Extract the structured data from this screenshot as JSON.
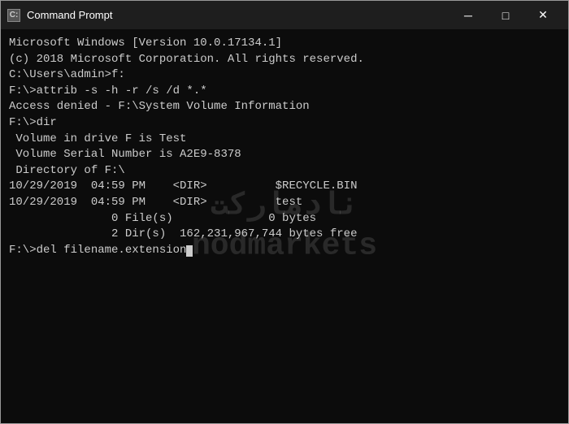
{
  "window": {
    "title": "Command Prompt",
    "icon_label": "C:",
    "controls": {
      "minimize": "─",
      "maximize": "□",
      "close": "✕"
    }
  },
  "terminal": {
    "lines": [
      "Microsoft Windows [Version 10.0.17134.1]",
      "(c) 2018 Microsoft Corporation. All rights reserved.",
      "",
      "C:\\Users\\admin>f:",
      "",
      "F:\\>attrib -s -h -r /s /d *.*",
      "Access denied - F:\\System Volume Information",
      "",
      "F:\\>dir",
      " Volume in drive F is Test",
      " Volume Serial Number is A2E9-8378",
      "",
      " Directory of F:\\",
      "",
      "10/29/2019  04:59 PM    <DIR>          $RECYCLE.BIN",
      "10/29/2019  04:59 PM    <DIR>          test",
      "               0 File(s)              0 bytes",
      "               2 Dir(s)  162,231,967,744 bytes free",
      "",
      "F:\\>del filename.extension"
    ],
    "prompt_cursor": true
  },
  "watermark": {
    "line1": "نادمارکت",
    "line2": "nodmarkets"
  }
}
